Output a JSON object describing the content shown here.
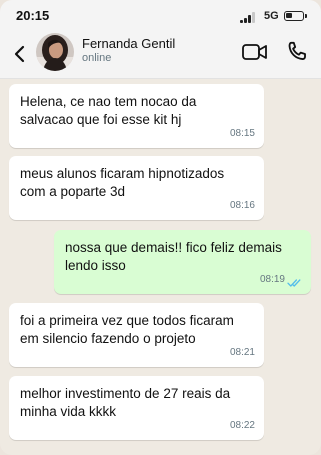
{
  "status_bar": {
    "time": "20:15",
    "network": "5G"
  },
  "header": {
    "contact_name": "Fernanda Gentil",
    "contact_status": "online",
    "icons": {
      "back": "chevron-left-icon",
      "video": "video-camera-icon",
      "call": "phone-icon"
    }
  },
  "colors": {
    "incoming_bubble": "#ffffff",
    "outgoing_bubble": "#d9fdd3",
    "chat_background": "#efeae2",
    "read_ticks": "#53bdeb"
  },
  "messages": [
    {
      "direction": "incoming",
      "text": "Helena, ce nao tem nocao da salvacao que foi esse kit hj",
      "time": "08:15"
    },
    {
      "direction": "incoming",
      "text": "meus alunos ficaram hipnotizados com a poparte 3d",
      "time": "08:16"
    },
    {
      "direction": "outgoing",
      "text": "nossa que demais!! fico feliz demais lendo isso",
      "time": "08:19",
      "status": "read"
    },
    {
      "direction": "incoming",
      "text": "foi a primeira vez que todos ficaram em silencio fazendo o projeto",
      "time": "08:21"
    },
    {
      "direction": "incoming",
      "text": "melhor investimento de 27 reais da minha vida kkkk",
      "time": "08:22"
    }
  ]
}
